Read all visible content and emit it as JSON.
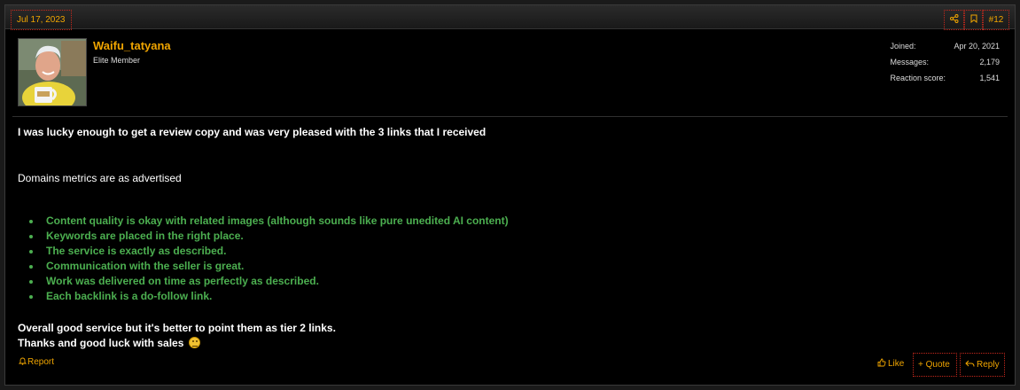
{
  "header": {
    "date": "Jul 17, 2023",
    "share_icon": "share-icon",
    "bookmark_icon": "bookmark-icon",
    "post_number": "#12"
  },
  "user": {
    "name": "Waifu_tatyana",
    "title": "Elite Member",
    "stats": [
      {
        "label": "Joined:",
        "value": "Apr 20, 2021"
      },
      {
        "label": "Messages:",
        "value": "2,179"
      },
      {
        "label": "Reaction score:",
        "value": "1,541"
      }
    ]
  },
  "content": {
    "intro": "I was lucky enough to get a review copy and was very pleased with the 3 links that I received",
    "metrics": "Domains metrics are as advertised",
    "bullets": [
      "Content quality is okay with related images (although sounds like pure unedited AI content)",
      "Keywords are placed in the right place.",
      "The service is exactly as described.",
      "Communication with the seller is great.",
      "Work was delivered on time as perfectly as described.",
      "Each backlink is a do-follow link."
    ],
    "closing1": "Overall good service but it's better to point them as tier 2 links.",
    "closing2": "Thanks and good luck with sales",
    "emoji": "smile-emoji"
  },
  "actions": {
    "report": "Report",
    "like": "Like",
    "quote": "Quote",
    "reply": "Reply"
  },
  "colors": {
    "accent": "#f0a500",
    "bullet_text": "#4caf50",
    "background": "#000000"
  }
}
